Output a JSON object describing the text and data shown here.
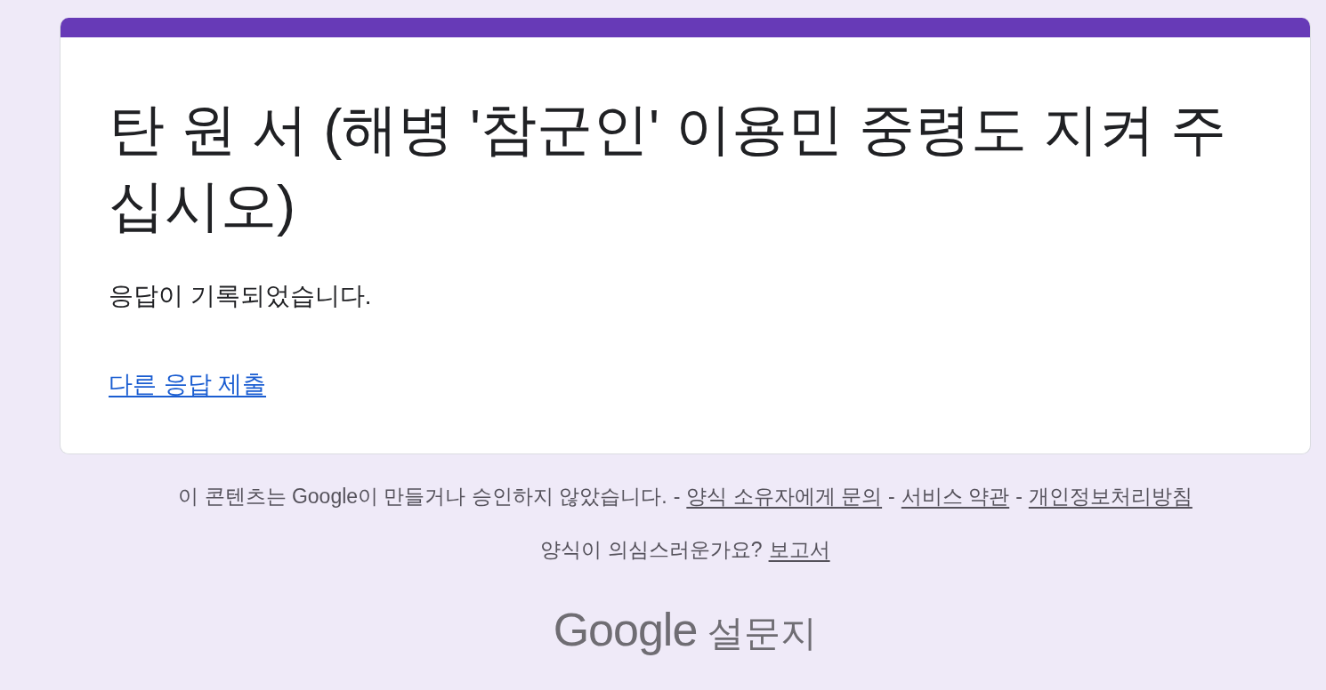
{
  "card": {
    "title": "탄 원 서 (해병 '참군인' 이용민 중령도 지켜 주십시오)",
    "message": "응답이 기록되었습니다.",
    "link": "다른 응답 제출"
  },
  "footer": {
    "lines": [
      [
        {
          "kind": "text",
          "text": "이 콘텐츠는 Google이 만들거나 승인하지 않았습니다."
        },
        {
          "kind": "separator",
          "text": "-"
        },
        {
          "kind": "link",
          "text": "양식 소유자에게 문의"
        },
        {
          "kind": "separator",
          "text": "-"
        },
        {
          "kind": "link",
          "text": "서비스 약관"
        },
        {
          "kind": "separator",
          "text": "-"
        },
        {
          "kind": "link",
          "text": "개인정보처리방침"
        }
      ],
      [
        {
          "kind": "text",
          "text": "양식이 의심스러운가요?"
        },
        {
          "kind": "link",
          "text": "보고서"
        }
      ]
    ]
  },
  "logo": {
    "wordmark": "Google",
    "product": "설문지"
  }
}
